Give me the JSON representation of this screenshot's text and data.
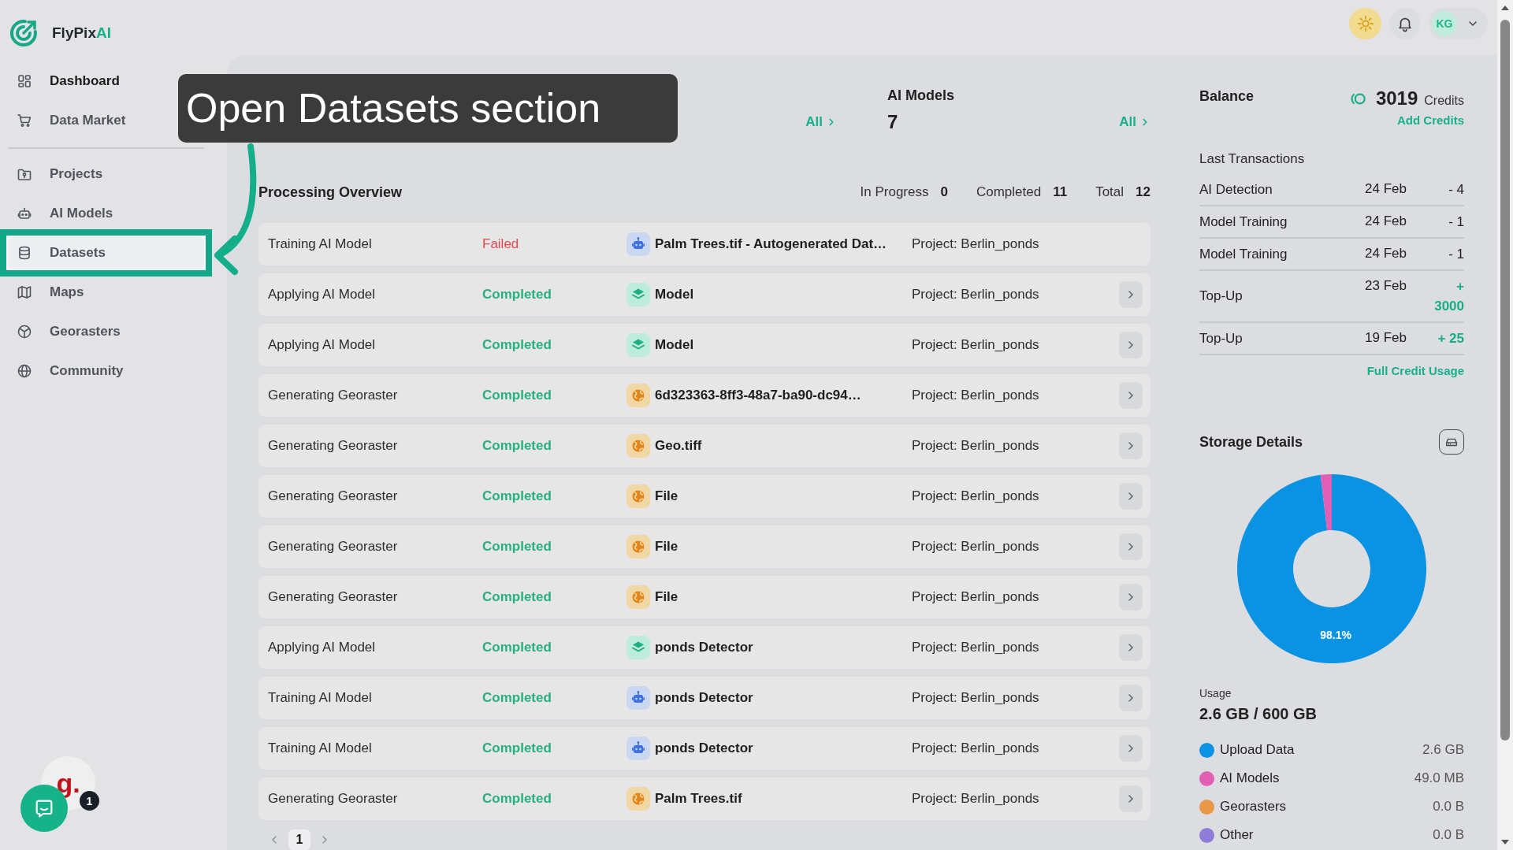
{
  "sidebar": {
    "logo": {
      "name": "FlyPix",
      "accent": "AI"
    },
    "sections": [
      {
        "items": [
          {
            "label": "Dashboard",
            "selected": true,
            "hovered": false,
            "highlighted": false
          },
          {
            "label": "Data Market",
            "selected": false,
            "hovered": false,
            "highlighted": false
          }
        ]
      },
      {
        "items": [
          {
            "label": "Projects",
            "selected": false,
            "hovered": false,
            "highlighted": false
          },
          {
            "label": "AI Models",
            "selected": false,
            "hovered": false,
            "highlighted": false
          },
          {
            "label": "Datasets",
            "selected": false,
            "hovered": true,
            "highlighted": true
          },
          {
            "label": "Maps",
            "selected": false,
            "hovered": false,
            "highlighted": false
          },
          {
            "label": "Georasters",
            "selected": false,
            "hovered": false,
            "highlighted": false
          },
          {
            "label": "Community",
            "selected": false,
            "hovered": false,
            "highlighted": false
          }
        ]
      }
    ]
  },
  "floating_widget": {
    "text": "g.",
    "badge": "1"
  },
  "header": {
    "user": {
      "initials": "KG"
    }
  },
  "callout": {
    "text": "Open Datasets section"
  },
  "stat_cards": [
    {
      "link": "All"
    },
    {
      "title": "AI Models",
      "count": "7",
      "link": "All"
    }
  ],
  "processing": {
    "title": "Processing Overview",
    "counters": [
      {
        "label": "In Progress",
        "value": "0"
      },
      {
        "label": "Completed",
        "value": "11"
      },
      {
        "label": "Total",
        "value": "12"
      }
    ],
    "rows": [
      {
        "kind": "training",
        "type": "Training AI Model",
        "status": "Failed",
        "failed": true,
        "name": "Palm Trees.tif - Autogenerated Dat…",
        "project": "Project: Berlin_ponds",
        "openable": false
      },
      {
        "kind": "applying",
        "type": "Applying AI Model",
        "status": "Completed",
        "failed": false,
        "name": "Model",
        "project": "Project: Berlin_ponds",
        "openable": true
      },
      {
        "kind": "applying",
        "type": "Applying AI Model",
        "status": "Completed",
        "failed": false,
        "name": "Model",
        "project": "Project: Berlin_ponds",
        "openable": true
      },
      {
        "kind": "georaster",
        "type": "Generating Georaster",
        "status": "Completed",
        "failed": false,
        "name": "6d323363-8ff3-48a7-ba90-dc94…",
        "project": "Project: Berlin_ponds",
        "openable": true
      },
      {
        "kind": "georaster",
        "type": "Generating Georaster",
        "status": "Completed",
        "failed": false,
        "name": "Geo.tiff",
        "project": "Project: Berlin_ponds",
        "openable": true
      },
      {
        "kind": "georaster",
        "type": "Generating Georaster",
        "status": "Completed",
        "failed": false,
        "name": "File",
        "project": "Project: Berlin_ponds",
        "openable": true
      },
      {
        "kind": "georaster",
        "type": "Generating Georaster",
        "status": "Completed",
        "failed": false,
        "name": "File",
        "project": "Project: Berlin_ponds",
        "openable": true
      },
      {
        "kind": "georaster",
        "type": "Generating Georaster",
        "status": "Completed",
        "failed": false,
        "name": "File",
        "project": "Project: Berlin_ponds",
        "openable": true
      },
      {
        "kind": "applying",
        "type": "Applying AI Model",
        "status": "Completed",
        "failed": false,
        "name": "ponds Detector",
        "project": "Project: Berlin_ponds",
        "openable": true
      },
      {
        "kind": "training",
        "type": "Training AI Model",
        "status": "Completed",
        "failed": false,
        "name": "ponds Detector",
        "project": "Project: Berlin_ponds",
        "openable": true
      },
      {
        "kind": "training",
        "type": "Training AI Model",
        "status": "Completed",
        "failed": false,
        "name": "ponds Detector",
        "project": "Project: Berlin_ponds",
        "openable": true
      },
      {
        "kind": "georaster",
        "type": "Generating Georaster",
        "status": "Completed",
        "failed": false,
        "name": "Palm Trees.tif",
        "project": "Project: Berlin_ponds",
        "openable": true
      }
    ],
    "pagination": {
      "pages": [
        {
          "label": "1",
          "selected": true
        }
      ]
    }
  },
  "balance": {
    "title": "Balance",
    "amount": "3019",
    "unit": "Credits",
    "add_link": "Add Credits",
    "transactions_title": "Last Transactions",
    "transactions": [
      {
        "label": "AI Detection",
        "date": "24 Feb",
        "amount": "- 4",
        "kind": "debit"
      },
      {
        "label": "Model Training",
        "date": "24 Feb",
        "amount": "- 1",
        "kind": "debit"
      },
      {
        "label": "Model Training",
        "date": "24 Feb",
        "amount": "- 1",
        "kind": "debit"
      },
      {
        "label": "Top-Up",
        "date": "23 Feb",
        "amount": "+ 3000",
        "kind": "credit"
      },
      {
        "label": "Top-Up",
        "date": "19 Feb",
        "amount": "+ 25",
        "kind": "credit"
      }
    ],
    "full_link": "Full Credit Usage"
  },
  "storage": {
    "title": "Storage Details",
    "chart_data": {
      "type": "donut",
      "values": [
        98.1,
        1.9,
        0,
        0
      ],
      "data_labels": true,
      "value_labels": [
        "98.1%",
        null,
        null,
        null
      ]
    },
    "usage_label": "Usage",
    "usage_value": "2.6 GB / 600 GB",
    "legend": [
      {
        "label": "Upload Data",
        "value": "2.6 GB",
        "color": "#0b93e3"
      },
      {
        "label": "AI Models",
        "value": "49.0 MB",
        "color": "#e25fb6"
      },
      {
        "label": "Georasters",
        "value": "0.0 B",
        "color": "#e99846"
      },
      {
        "label": "Other",
        "value": "0.0 B",
        "color": "#8f7bd8"
      }
    ]
  }
}
